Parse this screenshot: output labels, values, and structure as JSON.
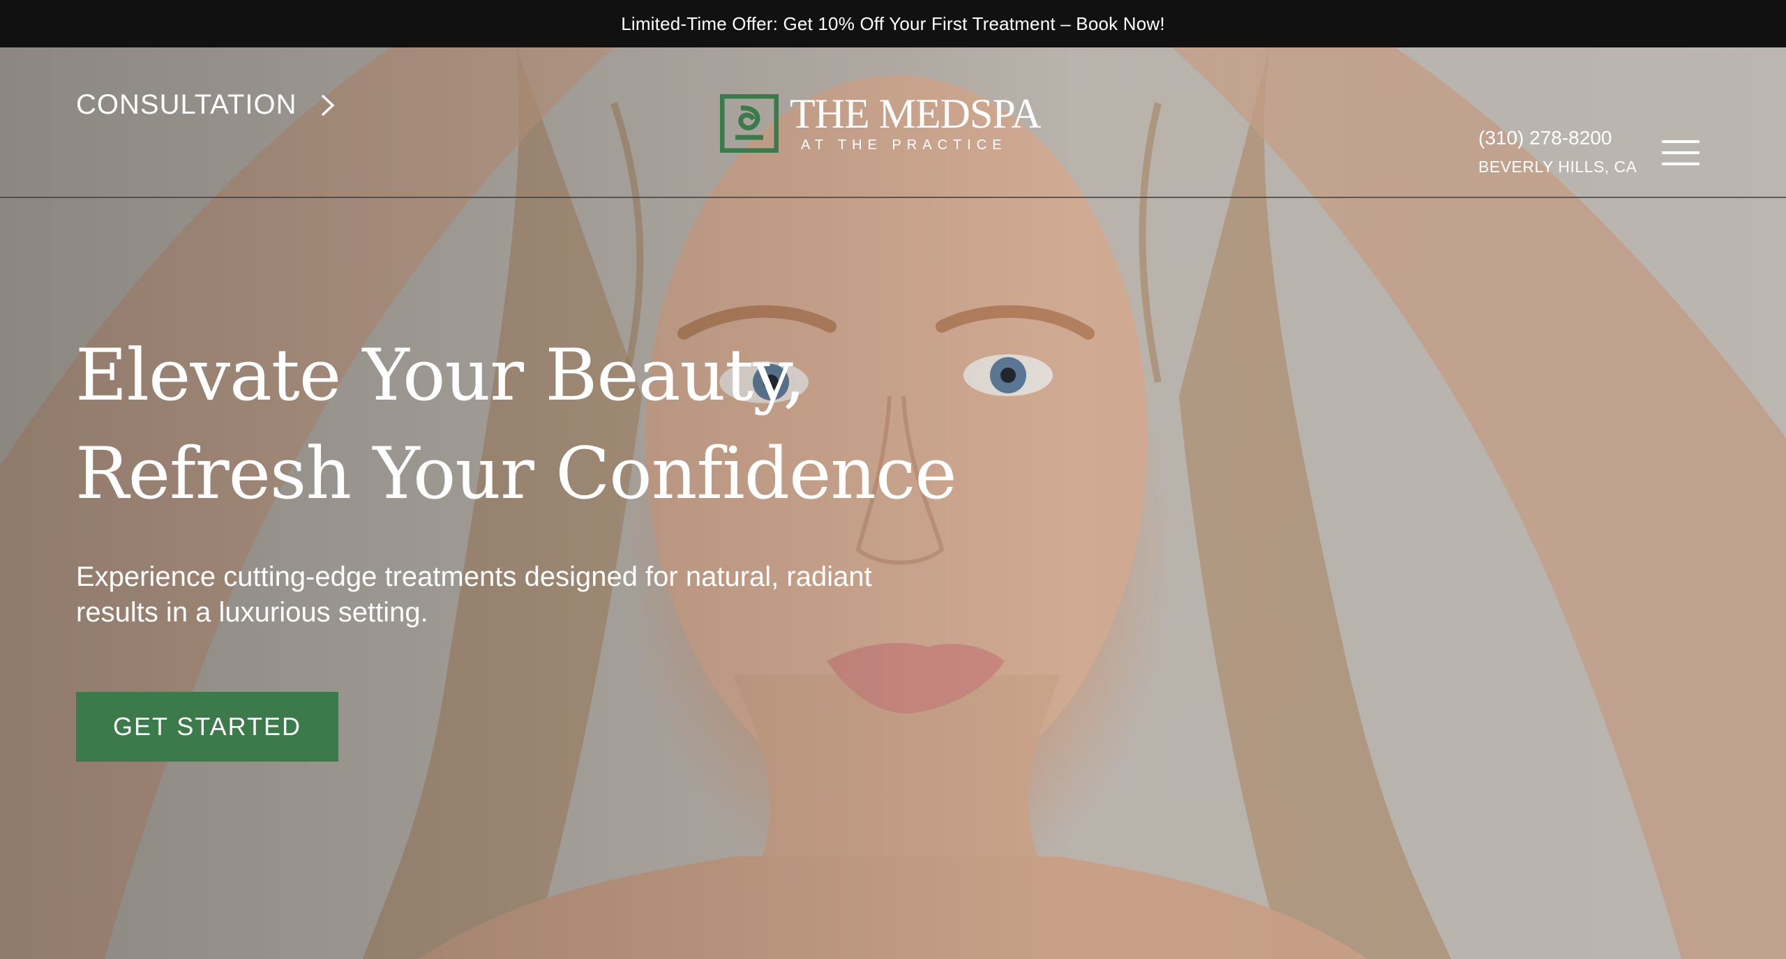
{
  "promo": {
    "text": "Limited-Time Offer: Get 10% Off Your First Treatment – Book Now!"
  },
  "header": {
    "consultation_label": "CONSULTATION",
    "logo": {
      "title": "THE MEDSPA",
      "subtitle": "AT THE PRACTICE"
    },
    "contact": {
      "phone": "(310) 278-8200",
      "location": "BEVERLY HILLS, CA"
    }
  },
  "hero": {
    "heading_line1": "Elevate Your Beauty,",
    "heading_line2": "Refresh Your Confidence",
    "subtext": "Experience cutting-edge treatments designed for natural, radiant results in a luxurious setting.",
    "cta_label": "GET STARTED"
  },
  "colors": {
    "brand_green": "#3d7a4b",
    "promo_bg": "#111111",
    "text": "#ffffff"
  },
  "icons": {
    "consultation": "chevron-right-icon",
    "menu": "hamburger-menu-icon",
    "logo": "medspa-monogram-icon"
  }
}
